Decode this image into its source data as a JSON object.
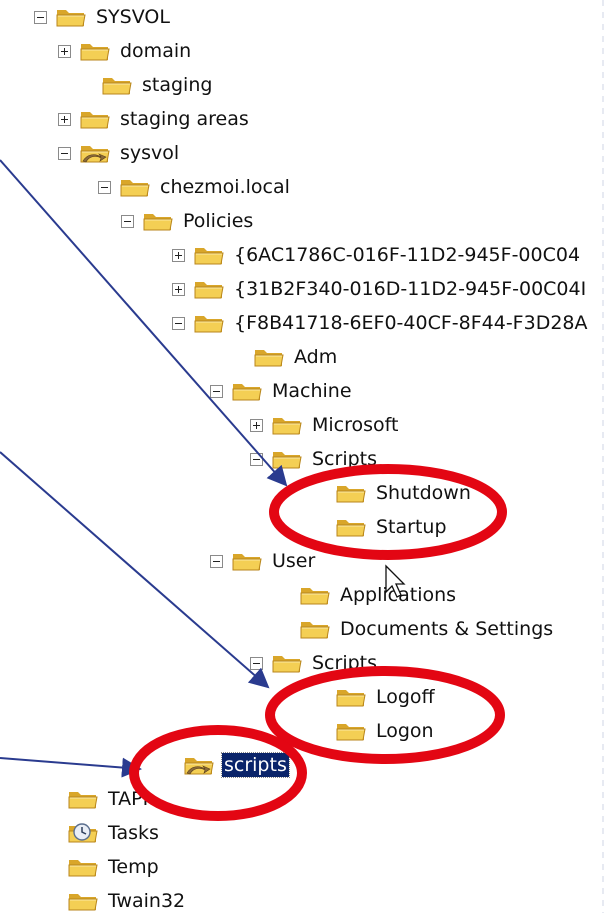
{
  "tree": {
    "items": [
      {
        "label": "SYSVOL",
        "expander": "minus",
        "icon": "folder-icon"
      },
      {
        "label": "domain",
        "expander": "plus",
        "icon": "folder-icon"
      },
      {
        "label": "staging",
        "expander": "none",
        "icon": "folder-icon"
      },
      {
        "label": "staging areas",
        "expander": "plus",
        "icon": "folder-icon"
      },
      {
        "label": "sysvol",
        "expander": "minus",
        "icon": "shared-folder-icon"
      },
      {
        "label": "chezmoi.local",
        "expander": "minus",
        "icon": "folder-icon"
      },
      {
        "label": "Policies",
        "expander": "minus",
        "icon": "folder-icon"
      },
      {
        "label": "{6AC1786C-016F-11D2-945F-00C04",
        "expander": "plus",
        "icon": "folder-icon"
      },
      {
        "label": "{31B2F340-016D-11D2-945F-00C04I",
        "expander": "plus",
        "icon": "folder-icon"
      },
      {
        "label": "{F8B41718-6EF0-40CF-8F44-F3D28A",
        "expander": "minus",
        "icon": "folder-icon"
      },
      {
        "label": "Adm",
        "expander": "none",
        "icon": "folder-icon"
      },
      {
        "label": "Machine",
        "expander": "minus",
        "icon": "folder-icon"
      },
      {
        "label": "Microsoft",
        "expander": "plus",
        "icon": "folder-icon"
      },
      {
        "label": "Scripts",
        "expander": "minus",
        "icon": "folder-icon"
      },
      {
        "label": "Shutdown",
        "expander": "none",
        "icon": "folder-icon"
      },
      {
        "label": "Startup",
        "expander": "none",
        "icon": "folder-icon"
      },
      {
        "label": "User",
        "expander": "minus",
        "icon": "folder-icon"
      },
      {
        "label": "Applications",
        "expander": "none",
        "icon": "folder-icon"
      },
      {
        "label": "Documents & Settings",
        "expander": "none",
        "icon": "folder-icon"
      },
      {
        "label": "Scripts",
        "expander": "minus",
        "icon": "folder-icon"
      },
      {
        "label": "Logoff",
        "expander": "none",
        "icon": "folder-icon"
      },
      {
        "label": "Logon",
        "expander": "none",
        "icon": "folder-icon"
      },
      {
        "label": "scripts",
        "expander": "none",
        "icon": "shared-folder-icon",
        "selected": true
      },
      {
        "label": "TAPI",
        "expander": "none",
        "icon": "folder-icon"
      },
      {
        "label": "Tasks",
        "expander": "none",
        "icon": "scheduled-tasks-icon"
      },
      {
        "label": "Temp",
        "expander": "none",
        "icon": "folder-icon"
      },
      {
        "label": "Twain32",
        "expander": "none",
        "icon": "folder-icon"
      }
    ]
  },
  "colors": {
    "highlight_ellipse": "#e30613",
    "arrow": "#2a3b8f",
    "selection_bg": "#0a246a",
    "folder_yellow": "#f4cf54"
  }
}
